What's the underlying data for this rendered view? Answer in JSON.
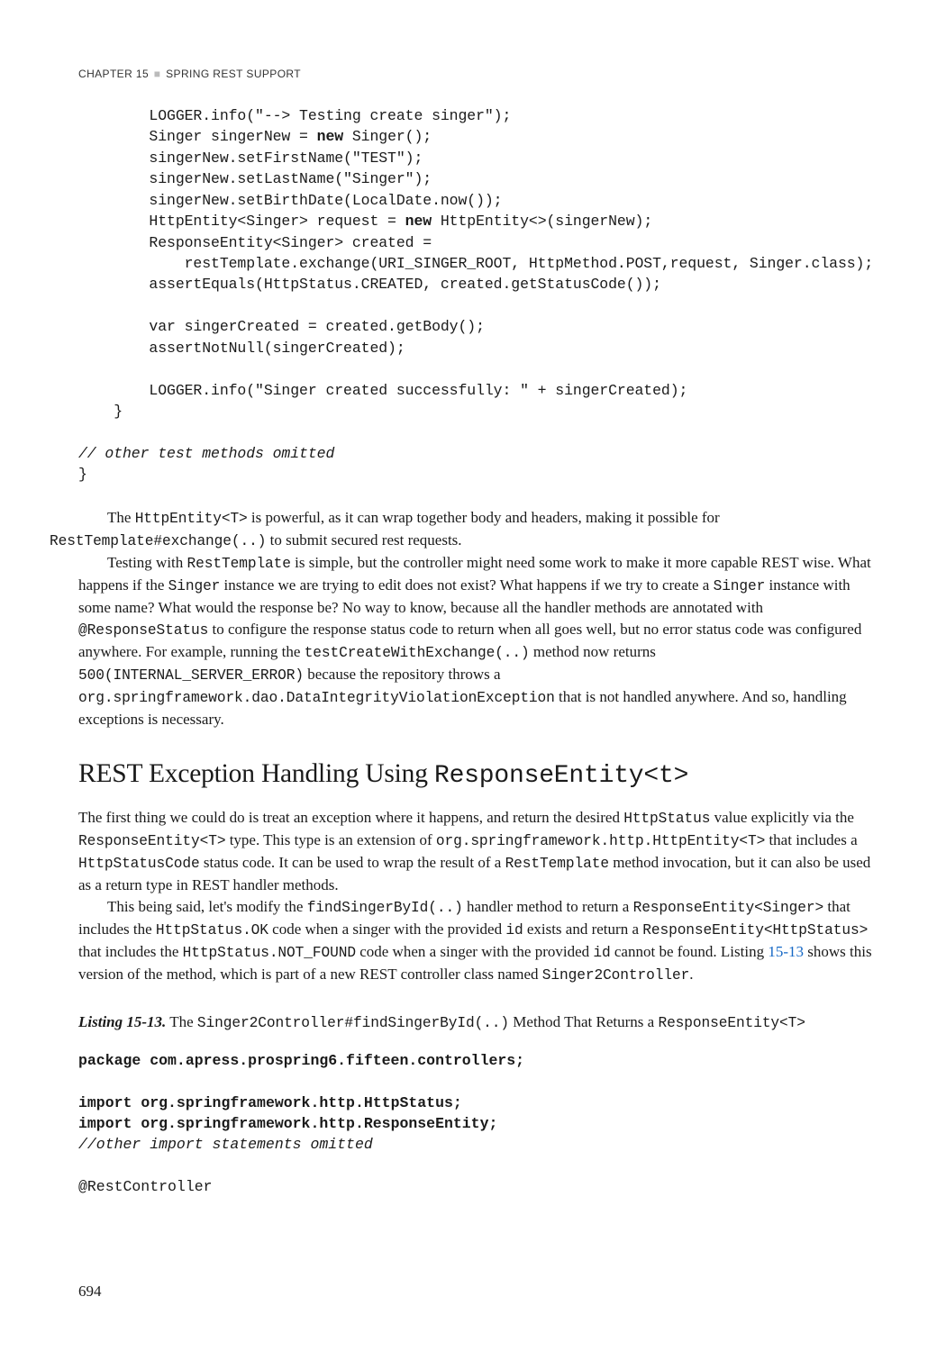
{
  "header": {
    "chapter": "CHAPTER 15",
    "title": "SPRING REST SUPPORT"
  },
  "code1": {
    "l1_a": "        LOGGER.info(\"--> Testing create singer\");",
    "l2_a": "        Singer singerNew = ",
    "l2_kw": "new",
    "l2_b": " Singer();",
    "l3": "        singerNew.setFirstName(\"TEST\");",
    "l4": "        singerNew.setLastName(\"Singer\");",
    "l5": "        singerNew.setBirthDate(LocalDate.now());",
    "l6_a": "        HttpEntity<Singer> request = ",
    "l6_kw": "new",
    "l6_b": " HttpEntity<>(singerNew);",
    "l7": "        ResponseEntity<Singer> created =",
    "l8": "            restTemplate.exchange(URI_SINGER_ROOT, HttpMethod.POST,request, Singer.class);",
    "l9": "        assertEquals(HttpStatus.CREATED, created.getStatusCode());",
    "l10": "",
    "l11": "        var singerCreated = created.getBody();",
    "l12": "        assertNotNull(singerCreated);",
    "l13": "",
    "l14": "        LOGGER.info(\"Singer created successfully: \" + singerCreated);",
    "l15": "    }",
    "l16": "",
    "l17": "// other test methods omitted",
    "l18": "}"
  },
  "para1": {
    "p1_a": "The ",
    "p1_c1": "HttpEntity<T>",
    "p1_b": " is powerful, as it can wrap together body and headers, making it possible for ",
    "p1_c2": "RestTemplate#exchange(..)",
    "p1_c": " to submit secured rest requests.",
    "p2_a": "Testing with ",
    "p2_c1": "RestTemplate",
    "p2_b": " is simple, but the controller might need some work to make it more capable REST wise. What happens if the ",
    "p2_c2": "Singer",
    "p2_c": " instance we are trying to edit does not exist? What happens if we try to create a ",
    "p2_c3": "Singer",
    "p2_d": " instance with some name? What would the response be? No way to know, because all the handler methods are annotated with ",
    "p2_c4": "@ResponseStatus",
    "p2_e": " to configure the response status code to return when all goes well, but no error status code was configured anywhere. For example, running the ",
    "p2_c5": "testCreateWithExchange(..)",
    "p2_f": " method now returns ",
    "p2_c6": "500(INTERNAL_SERVER_ERROR)",
    "p2_g": " because the repository throws a ",
    "p2_c7": "org.springframework.dao.DataIntegrityViolationException",
    "p2_h": " that is not handled anywhere. And so, handling exceptions is necessary."
  },
  "section_title": {
    "prefix": "REST Exception Handling Using ",
    "code": "ResponseEntity<t>"
  },
  "para2": {
    "p1_a": "The first thing we could do is treat an exception where it happens, and return the desired ",
    "p1_c1": "HttpStatus",
    "p1_b": " value explicitly via the ",
    "p1_c2": "ResponseEntity<T>",
    "p1_c": " type. This type is an extension of ",
    "p1_c3": "org.springframework.http.HttpEntity<T>",
    "p1_d": " that includes a ",
    "p1_c4": "HttpStatusCode",
    "p1_e": " status code. It can be used to wrap the result of a ",
    "p1_c5": "RestTemplate",
    "p1_f": " method invocation, but it can also be used as a return type in REST handler methods.",
    "p2_a": "This being said, let's modify the ",
    "p2_c1": "findSingerById(..)",
    "p2_b": " handler method to return a ",
    "p2_c2": "ResponseEntity<Singer>",
    "p2_c": " that includes the ",
    "p2_c3": "HttpStatus.OK",
    "p2_d": " code when a singer with the provided ",
    "p2_c4": "id",
    "p2_e": " exists and return a ",
    "p2_c5": "ResponseEntity<HttpStatus>",
    "p2_f": " that includes the ",
    "p2_c6": "HttpStatus.NOT_FOUND",
    "p2_g": " code when a singer with the provided ",
    "p2_c7": "id",
    "p2_h": " cannot be found. Listing ",
    "p2_link": "15-13",
    "p2_i": " shows this version of the method, which is part of a new REST controller class named ",
    "p2_c8": "Singer2Controller",
    "p2_j": "."
  },
  "listing": {
    "label": "Listing 15-13.",
    "desc_a": "  The ",
    "desc_c1": "Singer2Controller#findSingerById(..)",
    "desc_b": " Method That Returns a ",
    "desc_c2": "ResponseEntity<T>"
  },
  "code2": {
    "l1_kw": "package",
    "l1_b": " com.apress.prospring6.fifteen.controllers;",
    "l3_kw": "import",
    "l3_b": " org.springframework.http.HttpStatus;",
    "l4_kw": "import",
    "l4_b": " org.springframework.http.ResponseEntity;",
    "l5": "//other import statements omitted",
    "l7": "@RestController"
  },
  "page_number": "694"
}
